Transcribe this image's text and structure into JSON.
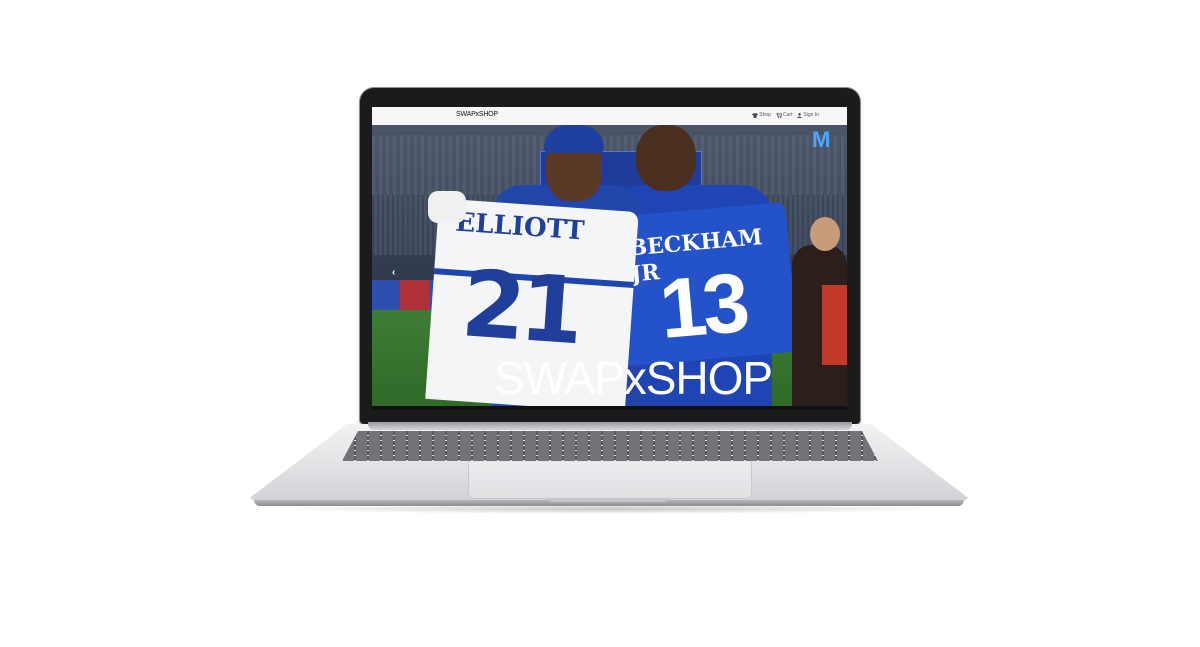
{
  "site": {
    "brand": "SWAPxSHOP"
  },
  "nav": {
    "links": [
      {
        "label": "Shop",
        "icon": "shirt-icon"
      },
      {
        "label": "Cart",
        "icon": "cart-icon"
      },
      {
        "label": "Sign In",
        "icon": "user-icon"
      }
    ]
  },
  "hero": {
    "title": "SWAPxSHOP",
    "prev_arrow": "‹"
  }
}
